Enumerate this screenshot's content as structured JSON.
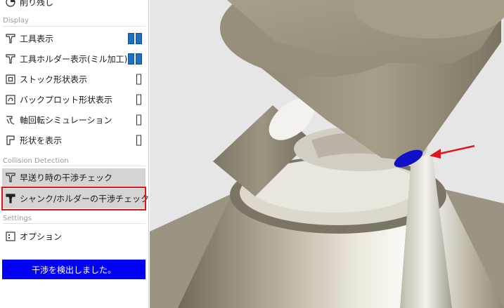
{
  "top_item": {
    "label": "削り残し",
    "icon": "restmaterial-icon"
  },
  "sections": {
    "display": "Display",
    "collision": "Collision Detection",
    "settings": "Settings"
  },
  "display_items": [
    {
      "label": "工具表示",
      "icon": "tool-icon",
      "state": "on"
    },
    {
      "label": "工具ホルダー表示(ミル加工)",
      "icon": "tool-holder-icon",
      "state": "on"
    },
    {
      "label": "ストック形状表示",
      "icon": "stock-icon",
      "state": "off"
    },
    {
      "label": "バックプロット形状表示",
      "icon": "backplot-icon",
      "state": "off"
    },
    {
      "label": "軸回転シミュレーション",
      "icon": "axis-rotation-icon",
      "state": "off"
    },
    {
      "label": "形状を表示",
      "icon": "shape-icon",
      "state": "off"
    }
  ],
  "collision_items": [
    {
      "label": "早送り時の干渉チェック",
      "icon": "rapid-check-icon"
    },
    {
      "label": "シャンク/ホルダーの干渉チェック",
      "icon": "shank-holder-check-icon"
    }
  ],
  "settings_items": [
    {
      "label": "オプション",
      "icon": "options-icon"
    }
  ],
  "status_message": "干渉を検出しました。",
  "colors": {
    "toggle_on": "#1f6fbf",
    "status_bg": "#0000f2",
    "highlight_outline": "#e0141b",
    "collision_marker": "#1010c8",
    "background_3d": "#e6e6e6"
  }
}
